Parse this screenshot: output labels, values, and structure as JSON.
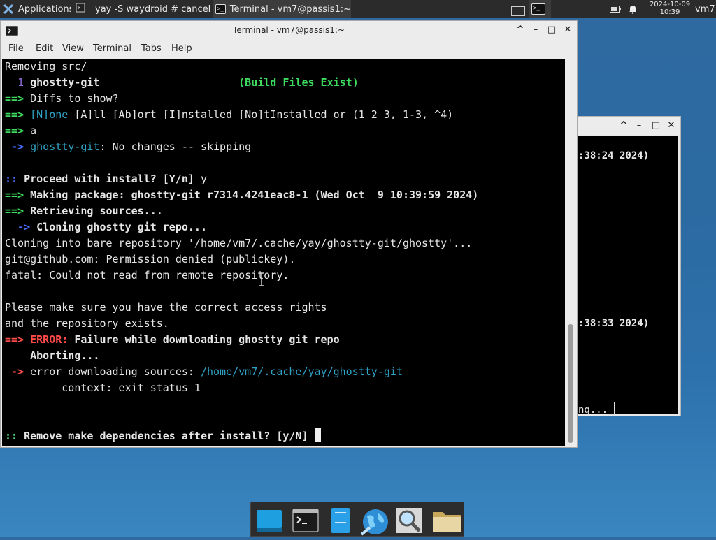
{
  "panel": {
    "applications_label": "Applications",
    "task1_label": "yay -S waydroid # cancel =...",
    "task2_label": "Terminal - vm7@passis1:~",
    "clock_date": "2024-10-09",
    "clock_time": "10:39",
    "user": "vm7"
  },
  "window": {
    "title": "Terminal - vm7@passis1:~",
    "menu": [
      "File",
      "Edit",
      "View",
      "Terminal",
      "Tabs",
      "Help"
    ]
  },
  "terminal": {
    "l1": "Removing src/",
    "l2_num": "1",
    "l2_pkg": "ghostty-git",
    "l2_tag": "(Build Files Exist)",
    "arrow": "==>",
    "l3": "Diffs to show?",
    "l4_none": "[N]one",
    "l4_rest": " [A]ll [Ab]ort [I]nstalled [No]tInstalled or (1 2 3, 1-3, ^4)",
    "l5": "a",
    "small_arrow": " ->",
    "l6_pkg": "ghostty-git",
    "l6_rest": ": No changes -- skipping",
    "colons": "::",
    "l8_prompt": "Proceed with install? [Y/n]",
    "l8_answer": " y",
    "l9": "Making package: ghostty-git r7314.4241eac8-1 (Wed Oct  9 10:39:59 2024)",
    "l10": "Retrieving sources...",
    "l11_arrow": "  ->",
    "l11": " Cloning ghostty git repo...",
    "l12": "Cloning into bare repository '/home/vm7/.cache/yay/ghostty-git/ghostty'...",
    "l13": "git@github.com: Permission denied (publickey).",
    "l14": "fatal: Could not read from remote repository.",
    "l16": "Please make sure you have the correct access rights",
    "l17": "and the repository exists.",
    "l18_error": "ERROR:",
    "l18_rest": " Failure while downloading ghostty git repo",
    "l19": "    Aborting...",
    "l20_rest": " error downloading sources: ",
    "l20_path": "/home/vm7/.cache/yay/ghostty-git",
    "l21": "         context: exit status 1",
    "l24": "Remove make dependencies after install? [y/N]"
  },
  "background_window": {
    "line1": ":38:24 2024)",
    "line2": ":38:33 2024)",
    "line3": "ng..."
  },
  "dock": {
    "items": [
      "desktop-icon",
      "terminal-icon",
      "file-manager-icon",
      "web-browser-icon",
      "search-icon",
      "folder-icon"
    ]
  }
}
